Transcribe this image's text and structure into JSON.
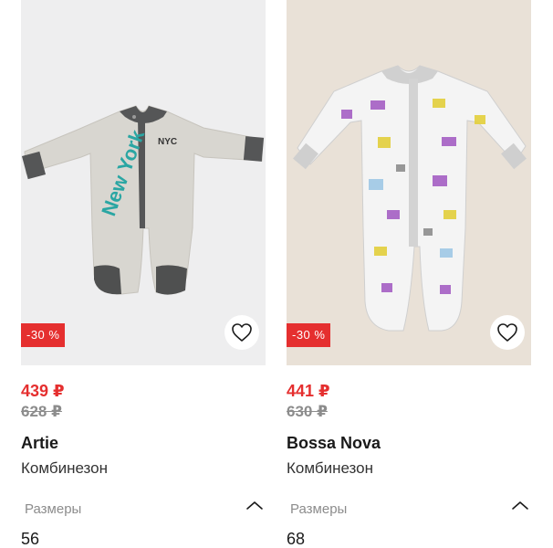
{
  "products": [
    {
      "discount_badge": "-30 %",
      "price_new": "439 ₽",
      "price_old": "628 ₽",
      "brand": "Artie",
      "type": "Комбинезон",
      "sizes_label": "Размеры",
      "size_value": "56",
      "print_text": "New York"
    },
    {
      "discount_badge": "-30 %",
      "price_new": "441 ₽",
      "price_old": "630 ₽",
      "brand": "Bossa Nova",
      "type": "Комбинезон",
      "sizes_label": "Размеры",
      "size_value": "68"
    }
  ],
  "icons": {
    "favorite": "heart-icon",
    "toggle": "chevron-up-icon"
  },
  "colors": {
    "accent": "#e52f2f",
    "old_price": "#8c8c8c",
    "text": "#1a1a1a"
  }
}
